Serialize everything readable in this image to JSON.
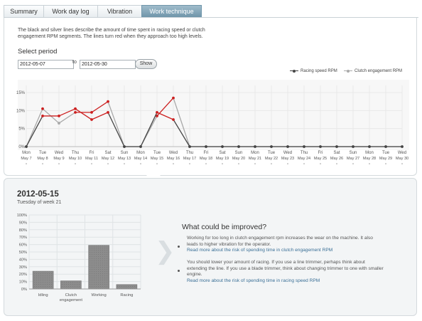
{
  "tabs": [
    {
      "label": "Summary",
      "active": false
    },
    {
      "label": "Work day log",
      "active": false
    },
    {
      "label": "Vibration",
      "active": false
    },
    {
      "label": "Work technique",
      "active": true
    }
  ],
  "intro": "The black and silver lines describe the amount of time spent in racing speed or clutch engagement RPM segments. The lines turn red when they approach too high levels.",
  "select_period": {
    "title": "Select period",
    "from": "2012-05-07",
    "to_label": "to",
    "to": "2012-05-30",
    "show_label": "Show"
  },
  "colors": {
    "racing": "#444444",
    "clutch": "#a9a9a9",
    "warning": "#cc1f1f",
    "grid": "#e8e8e8"
  },
  "chart_data": [
    {
      "type": "line",
      "legend_position": "top-right",
      "ylim": [
        0,
        15
      ],
      "yticks": [
        "0%",
        "5%",
        "10%",
        "15%"
      ],
      "ytick_values": [
        0,
        5,
        10,
        15
      ],
      "warn_threshold": 7,
      "x_days": [
        "Mon",
        "Tue",
        "Wed",
        "Thu",
        "Fri",
        "Sat",
        "Sun",
        "Mon",
        "Tue",
        "Wed",
        "Thu",
        "Fri",
        "Sat",
        "Sun",
        "Mon",
        "Tue",
        "Wed",
        "Thu",
        "Fri",
        "Sat",
        "Sun",
        "Mon",
        "Tue",
        "Wed"
      ],
      "x_dates": [
        "May 7",
        "May 8",
        "May 9",
        "May 10",
        "May 11",
        "May 12",
        "May 13",
        "May 14",
        "May 15",
        "May 16",
        "May 17",
        "May 18",
        "May 19",
        "May 20",
        "May 21",
        "May 22",
        "May 23",
        "May 24",
        "May 25",
        "May 26",
        "May 27",
        "May 28",
        "May 29",
        "May 30"
      ],
      "series": [
        {
          "name": "Racing speed RPM",
          "values": [
            0,
            8.5,
            8.5,
            10.5,
            7.5,
            9.5,
            0,
            0,
            9.5,
            7.5,
            0,
            0,
            0,
            0,
            0,
            0,
            0,
            0,
            0,
            0,
            0,
            0,
            0,
            0
          ]
        },
        {
          "name": "Clutch engagement RPM",
          "values": [
            0,
            10.5,
            6.5,
            9.5,
            9.5,
            12.5,
            0,
            0,
            8.5,
            13.5,
            0,
            0,
            0,
            0,
            0,
            0,
            0,
            0,
            0,
            0,
            0,
            0,
            0,
            0
          ]
        }
      ]
    },
    {
      "type": "bar",
      "categories": [
        "Idling",
        "Clutch engagement",
        "Working",
        "Racing"
      ],
      "values": [
        24,
        11,
        59,
        6
      ],
      "ylim": [
        0,
        100
      ],
      "yticks": [
        "0%",
        "10%",
        "20%",
        "30%",
        "40%",
        "50%",
        "60%",
        "70%",
        "80%",
        "90%",
        "100%"
      ],
      "ytick_values": [
        0,
        10,
        20,
        30,
        40,
        50,
        60,
        70,
        80,
        90,
        100
      ]
    }
  ],
  "detail": {
    "date": "2012-05-15",
    "subtitle": "Tuesday of week 21",
    "improve_title": "What could be improved?",
    "bullets": [
      {
        "text": "Working for too long in clutch engagement rpm increases the wear on the machine. It also leads to higher vibration for the operator.",
        "link": "Read more about the risk of spending time in clutch engagement RPM"
      },
      {
        "text": "You should lower your amount of racing. If you use a line trimmer, perhaps think about extending the line. If you use a blade trimmer, think about changing trimmer to one with smaller engine.",
        "link": "Read more about the risk of spending time in racing speed RPM"
      }
    ]
  }
}
